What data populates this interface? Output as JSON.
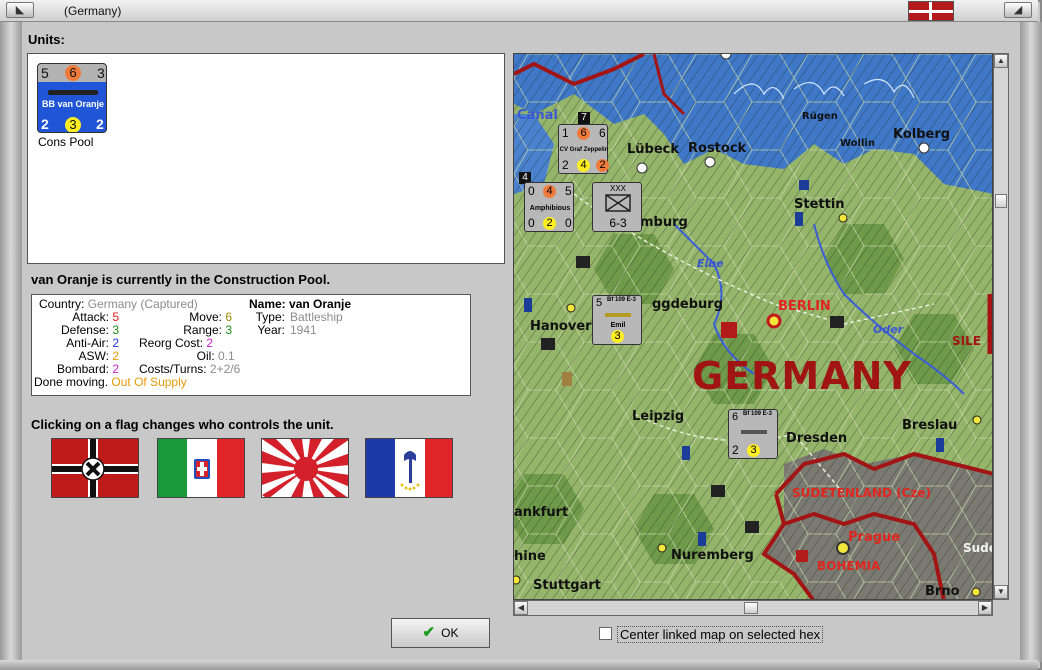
{
  "window": {
    "title": "(Germany)",
    "buttons": {
      "left": "◣",
      "close": "◢"
    }
  },
  "units": {
    "label": "Units:",
    "unit": {
      "top_left": "5",
      "top_center": "6",
      "top_right": "3",
      "name": "BB van Oranje",
      "bottom_left": "2",
      "bottom_center": "3",
      "bottom_right": "2",
      "caption": "Cons Pool"
    }
  },
  "status_line": "van Oranje is currently in the Construction Pool.",
  "info": {
    "country_label": "Country:",
    "country_value": "Germany (Captured)",
    "attack_label": "Attack:",
    "attack_value": "5",
    "defense_label": "Defense:",
    "defense_value": "3",
    "antiair_label": "Anti-Air:",
    "antiair_value": "2",
    "asw_label": "ASW:",
    "asw_value": "2",
    "bombard_label": "Bombard:",
    "bombard_value": "2",
    "done_moving_label": "Done moving.",
    "done_moving_value": "Out Of Supply",
    "move_label": "Move:",
    "move_value": "6",
    "range_label": "Range:",
    "range_value": "3",
    "reorg_label": "Reorg Cost:",
    "reorg_value": "2",
    "oil_label": "Oil:",
    "oil_value": "0.1",
    "costs_label": "Costs/Turns:",
    "costs_value": "2+2/6",
    "name_label": "Name:",
    "name_value": "van Oranje",
    "type_label": "Type:",
    "type_value": "Battleship",
    "year_label": "Year:",
    "year_value": "1941"
  },
  "flags": {
    "hint": "Clicking on a flag changes who controls the unit.",
    "items": [
      "germany-flag",
      "italy-flag",
      "japan-flag",
      "vichy-france-flag"
    ]
  },
  "ok_button": {
    "label": "OK"
  },
  "map": {
    "big_label": "GERMANY",
    "cities": {
      "canal": "Canal",
      "lubeck": "Lübeck",
      "rostock": "Rostock",
      "rugen": "Rügen",
      "wollin": "Wollin",
      "kolberg": "Kolberg",
      "stettin": "Stettin",
      "hamburg": "mburg",
      "elbe": "Elbe",
      "hannover": "Hanover",
      "magdeburg": "ggdeburg",
      "berlin": "BERLIN",
      "oder": "Oder",
      "silesia": "SILE",
      "leipzig": "Leipzig",
      "dresden": "Dresden",
      "breslau": "Breslau",
      "sudetenland": "SUDETENLAND (Cze)",
      "frankfurt": "ankfurt",
      "prague": "Prague",
      "sude": "Sude",
      "rhine": "hine",
      "nuremberg": "Nuremberg",
      "bohemia": "BOHEMIA",
      "stuttgart": "Stuttgart",
      "brno": "Brno"
    },
    "counters": {
      "zeppelin": {
        "tl": "1",
        "tc": "6",
        "tr": "6",
        "name": "CV Graf Zeppelin",
        "bl": "2",
        "bc": "4",
        "br": "2",
        "badge": "7"
      },
      "amphibious": {
        "tl": "0",
        "tc": "4",
        "tr": "5",
        "name": "Amphibious",
        "bl": "0",
        "bc": "2",
        "br": "0",
        "badge": "4"
      },
      "infantry": {
        "top": "XXX",
        "bottom": "6-3"
      },
      "bf109_emil": {
        "tl": "5",
        "model": "Bf 109 E-3",
        "name": "Emil",
        "bc": "3"
      },
      "bf109_dresden": {
        "tl": "6",
        "model": "Bf 109 E-3",
        "bl": "2",
        "bc": "3"
      }
    }
  },
  "center_option": {
    "label": "Center linked map on selected hex",
    "checked": false
  },
  "colors": {
    "sea": "#3f78c8",
    "land": "#8fae63",
    "border_red": "#a31414",
    "germany_text": "#a11414",
    "counter_blue": "#1f55d6"
  }
}
